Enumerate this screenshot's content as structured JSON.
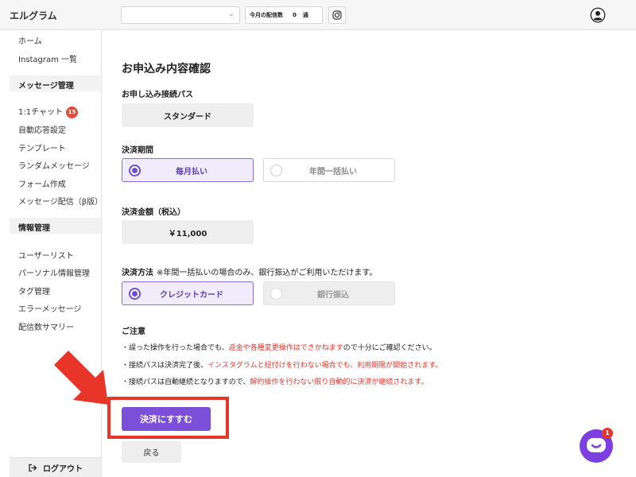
{
  "header": {
    "logo": "エルグラム",
    "monthly_label": "今月の配信数",
    "monthly_count": "0",
    "monthly_unit": "通"
  },
  "sidebar": {
    "items_top": [
      "ホーム",
      "Instagram 一覧"
    ],
    "section_message": "メッセージ管理",
    "chat_label": "1:1チャット",
    "chat_badge": "15",
    "message_items": [
      "自動応答設定",
      "テンプレート",
      "ランダムメッセージ",
      "フォーム作成",
      "メッセージ配信（β版）"
    ],
    "section_info": "情報管理",
    "info_items": [
      "ユーザーリスト",
      "パーソナル情報管理",
      "タグ管理",
      "エラーメッセージ",
      "配信数サマリー"
    ],
    "logout": "ログアウト"
  },
  "main": {
    "title": "お申込み内容確認",
    "pass_label": "お申し込み接続パス",
    "pass_value": "スタンダード",
    "period_label": "決済期間",
    "period_options": [
      "毎月払い",
      "年間一括払い"
    ],
    "amount_label": "決済金額（税込）",
    "amount_value": "￥11,000",
    "method_label": "決済方法",
    "method_note": "※年間一括払いの場合のみ、銀行振込がご利用いただけます。",
    "method_options": [
      "クレジットカード",
      "銀行振込"
    ],
    "caution_title": "ご注意",
    "caution_1a": "・誤った操作を行った場合でも、",
    "caution_1b": "返金や各種変更操作はできかねます",
    "caution_1c": "ので十分にご確認ください。",
    "caution_2a": "・接続パスは決済完了後、",
    "caution_2b": "インスタグラムと紐付けを行わない場合でも、利用期限が開始されます。",
    "caution_3a": "・接続パスは自動継続となりますので、",
    "caution_3b": "解約操作を行わない限り自動的に決済が継続されます。",
    "submit": "決済にすすむ",
    "back": "戻る"
  },
  "chat_widget": {
    "badge": "1"
  },
  "colors": {
    "accent": "#7c4fd8",
    "alert": "#e8352a"
  }
}
